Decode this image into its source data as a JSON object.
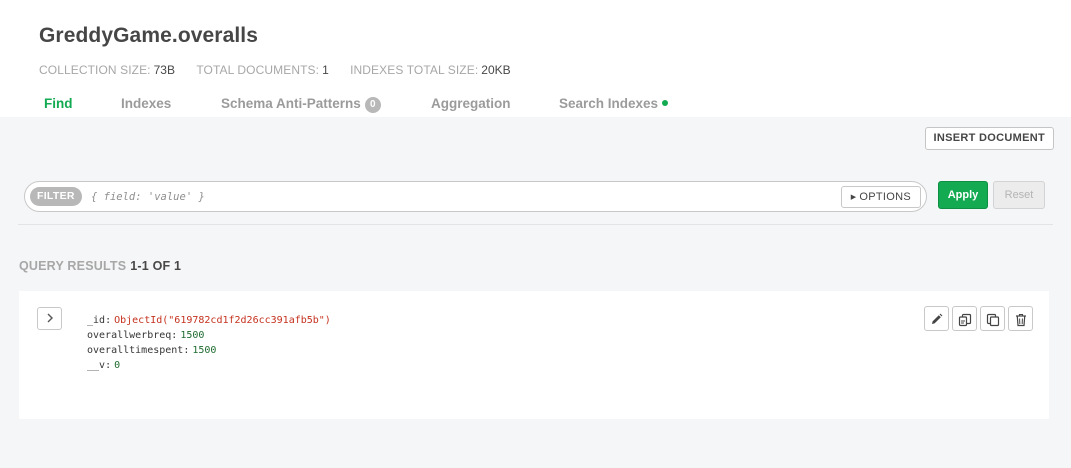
{
  "header": {
    "title": "GreddyGame.overalls",
    "stats": [
      {
        "label": "COLLECTION SIZE:",
        "value": "73B"
      },
      {
        "label": "TOTAL DOCUMENTS:",
        "value": "1"
      },
      {
        "label": "INDEXES TOTAL SIZE:",
        "value": "20KB"
      }
    ]
  },
  "tabs": [
    {
      "label": "Find",
      "active": true
    },
    {
      "label": "Indexes"
    },
    {
      "label": "Schema Anti-Patterns",
      "badge": "0"
    },
    {
      "label": "Aggregation"
    },
    {
      "label": "Search Indexes",
      "dot": true
    }
  ],
  "toolbar": {
    "insert_label": "INSERT DOCUMENT"
  },
  "filter": {
    "pill_label": "FILTER",
    "value": "",
    "placeholder": "{ field: 'value' }",
    "options_label": "OPTIONS",
    "apply_label": "Apply",
    "reset_label": "Reset"
  },
  "results": {
    "title": "QUERY RESULTS",
    "range": "1-1 OF 1"
  },
  "document": {
    "fields": [
      {
        "key": "_id",
        "value": "ObjectId(\"619782cd1f2d26cc391afb5b\")",
        "type": "oid"
      },
      {
        "key": "overallwerbreq",
        "value": "1500",
        "type": "num"
      },
      {
        "key": "overalltimespent",
        "value": "1500",
        "type": "num"
      },
      {
        "key": "__v",
        "value": "0",
        "type": "num"
      }
    ]
  },
  "colors": {
    "accent": "#13aa52",
    "oid": "#c5311e",
    "number": "#1d6b2f"
  },
  "icons": {
    "expand": "chevron-right-icon",
    "edit": "pencil-icon",
    "copy": "copy-icon",
    "clone": "clone-icon",
    "delete": "trash-icon"
  }
}
